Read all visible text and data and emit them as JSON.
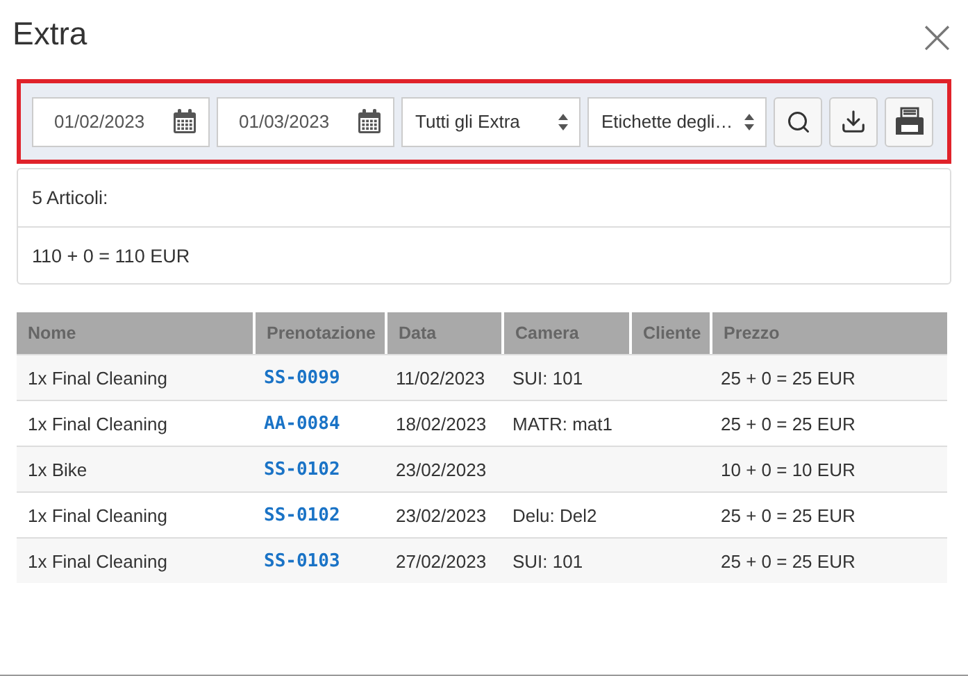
{
  "dialog": {
    "title": "Extra",
    "close": "×"
  },
  "filters": {
    "date_from": "01/02/2023",
    "date_to": "01/03/2023",
    "extra_select": "Tutti gli Extra",
    "labels_select": "Etichette degli…"
  },
  "summary": [
    "5 Articoli:",
    "110 + 0 = 110 EUR"
  ],
  "table": {
    "columns": [
      "Nome",
      "Prenotazione",
      "Data",
      "Camera",
      "Cliente",
      "Prezzo"
    ],
    "rows": [
      {
        "nome": "1x Final Cleaning",
        "prenotazione": "SS-0099",
        "data": "11/02/2023",
        "camera": "SUI: 101",
        "prezzo": "25 + 0 = 25 EUR"
      },
      {
        "nome": "1x Final Cleaning",
        "prenotazione": "AA-0084",
        "data": "18/02/2023",
        "camera": "MATR: mat1",
        "prezzo": "25 + 0 = 25 EUR"
      },
      {
        "nome": "1x Bike",
        "prenotazione": "SS-0102",
        "data": "23/02/2023",
        "prezzo": "10 + 0 = 10 EUR"
      },
      {
        "nome": "1x Final Cleaning",
        "prenotazione": "SS-0102",
        "data": "23/02/2023",
        "camera": "Delu: Del2",
        "prezzo": "25 + 0 = 25 EUR"
      },
      {
        "nome": "1x Final Cleaning",
        "prenotazione": "SS-0103",
        "data": "27/02/2023",
        "camera": "SUI: 101",
        "prezzo": "25 + 0 = 25 EUR"
      }
    ]
  }
}
